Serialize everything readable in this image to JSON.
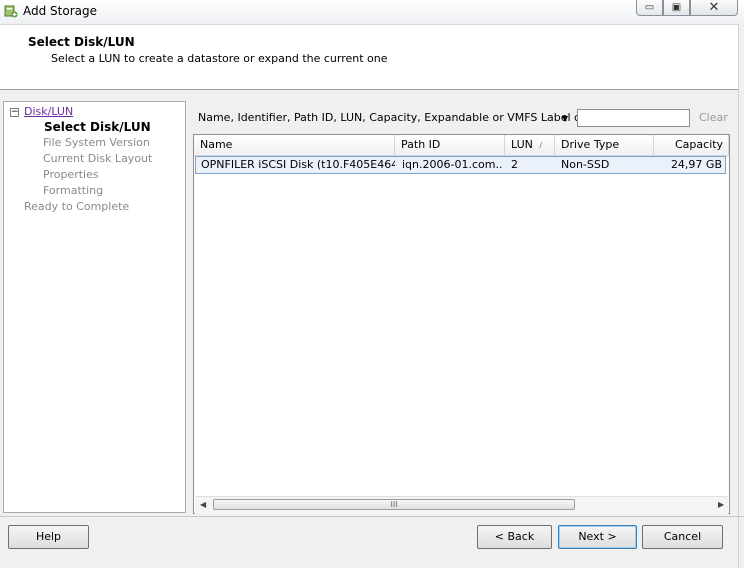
{
  "window": {
    "title": "Add Storage",
    "minimize_icon": "minimize-icon",
    "maximize_icon": "maximize-icon",
    "close_icon": "close-icon"
  },
  "header": {
    "title": "Select Disk/LUN",
    "subtitle": "Select a LUN to create a datastore or expand the current one"
  },
  "nav": {
    "section": "Disk/LUN",
    "items": [
      {
        "label": "Select Disk/LUN",
        "state": "current"
      },
      {
        "label": "File System Version",
        "state": "disabled"
      },
      {
        "label": "Current Disk Layout",
        "state": "disabled"
      },
      {
        "label": "Properties",
        "state": "disabled"
      },
      {
        "label": "Formatting",
        "state": "disabled"
      }
    ],
    "final": "Ready to Complete"
  },
  "filter": {
    "label": "Name, Identifier, Path ID, LUN, Capacity, Expandable or VMFS Label c...",
    "search_value": "",
    "clear_label": "Clear"
  },
  "table": {
    "columns": [
      "Name",
      "Path ID",
      "LUN",
      "Drive Type",
      "Capacity"
    ],
    "sort_indicator": "/",
    "rows": [
      {
        "name": "OPNFILER iSCSI Disk (t10.F405E464...",
        "path_id": "iqn.2006-01.com....",
        "lun": "2",
        "drive_type": "Non-SSD",
        "capacity": "24,97 GB"
      }
    ],
    "scroll_grip": "III"
  },
  "buttons": {
    "help": "Help",
    "back": "< Back",
    "next": "Next >",
    "cancel": "Cancel"
  }
}
